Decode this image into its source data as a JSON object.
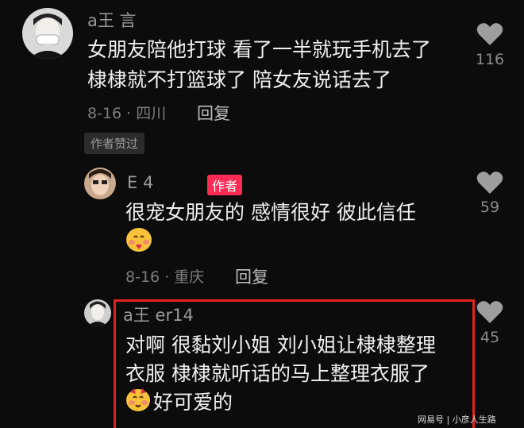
{
  "comments": [
    {
      "username": "a王          言",
      "text_line1": "女朋友陪他打球 看了一半就玩手机去了",
      "text_line2": "棣棣就不打篮球了 陪女友说话去了",
      "date_location": "8-16 · 四川",
      "reply_label": "回复",
      "liked_badge": "作者赞过",
      "like_count": "116"
    },
    {
      "username": "E          4",
      "author_badge": "作者",
      "text_line1": "很宠女朋友的 感情很好 彼此信任",
      "date_location": "8-16 · 重庆",
      "reply_label": "回复",
      "like_count": "59"
    },
    {
      "username": "a王                    er14",
      "text_line1": "对啊 很黏刘小姐 刘小姐让棣棣整理",
      "text_line2": "衣服 棣棣就听话的马上整理衣服了",
      "text_line3": "好可爱的",
      "like_count": "45"
    }
  ],
  "watermark": "网易号 | 小彦人生路"
}
